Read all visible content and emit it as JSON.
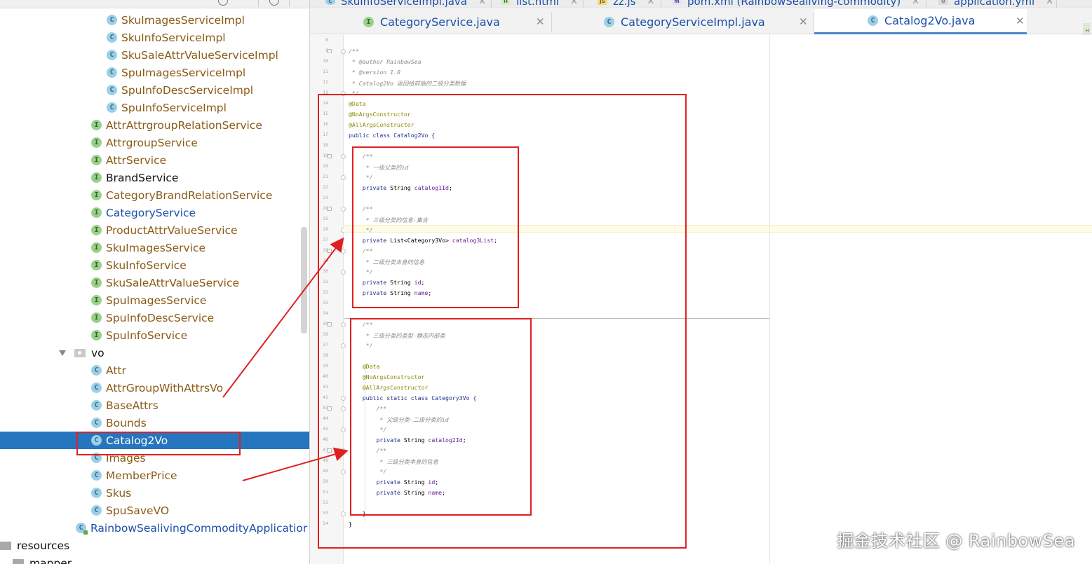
{
  "top_tabs": [
    {
      "label": "SkuInfoServiceImpl.java"
    },
    {
      "label": "list.html"
    },
    {
      "label": "zz.js"
    },
    {
      "label": "pom.xml (RainbowSealiving-commodity)"
    },
    {
      "label": "application.yml"
    }
  ],
  "editor_tabs": [
    {
      "label": "CategoryService.java",
      "icon": "interface-icon",
      "active": false
    },
    {
      "label": "CategoryServiceImpl.java",
      "icon": "class-icon",
      "active": false
    },
    {
      "label": "Catalog2Vo.java",
      "icon": "class-icon",
      "active": true
    }
  ],
  "tree": {
    "impl_items": [
      "SkuImagesServiceImpl",
      "SkuInfoServiceImpl",
      "SkuSaleAttrValueServiceImpl",
      "SpuImagesServiceImpl",
      "SpuInfoDescServiceImpl",
      "SpuInfoServiceImpl"
    ],
    "service_items": [
      "AttrAttrgroupRelationService",
      "AttrgroupService",
      "AttrService",
      "BrandService",
      "CategoryBrandRelationService",
      "CategoryService",
      "ProductAttrValueService",
      "SkuImagesService",
      "SkuInfoService",
      "SkuSaleAttrValueService",
      "SpuImagesService",
      "SpuInfoDescService",
      "SpuInfoService"
    ],
    "vo_folder": "vo",
    "vo_items": [
      "Attr",
      "AttrGroupWithAttrsVo",
      "BaseAttrs",
      "Bounds",
      "Catalog2Vo",
      "Images",
      "MemberPrice",
      "Skus",
      "SpuSaveVO"
    ],
    "selected": "Catalog2Vo",
    "app_class": "RainbowSealivingCommodityApplicatior",
    "resources_folder": "resources",
    "mapper_folder": "mapper"
  },
  "code": {
    "line_numbers": [
      "8",
      "9",
      "10",
      "11",
      "12",
      "13",
      "14",
      "15",
      "16",
      "17",
      "18",
      "19",
      "20",
      "21",
      "22",
      "23",
      "24",
      "25",
      "26",
      "27",
      "28",
      "29",
      "30",
      "31",
      "32",
      "33",
      "34",
      "35",
      "36",
      "37",
      "38",
      "39",
      "40",
      "41",
      "42",
      "43",
      "44",
      "45",
      "46",
      "47",
      "48",
      "49",
      "50",
      "51",
      "52",
      "53",
      "54"
    ],
    "lines": [
      {
        "t": "",
        "k": "plain"
      },
      {
        "t": "/**",
        "k": "cmt"
      },
      {
        "t": " * @author RainbowSea",
        "k": "cmt"
      },
      {
        "t": " * @version 1.0",
        "k": "cmt"
      },
      {
        "t": " * Catalog2Vo 返回给前端的二级分类数据",
        "k": "cmt"
      },
      {
        "t": " */",
        "k": "cmt"
      },
      {
        "t": "@Data",
        "k": "ann"
      },
      {
        "t": "@NoArgsConstructor",
        "k": "ann"
      },
      {
        "t": "@AllArgsConstructor",
        "k": "ann"
      },
      {
        "t": "public class Catalog2Vo {",
        "k": "kw"
      },
      {
        "t": "",
        "k": "plain"
      },
      {
        "t": "    /**",
        "k": "cmt"
      },
      {
        "t": "     * 一级父类的id",
        "k": "cmt"
      },
      {
        "t": "     */",
        "k": "cmt"
      },
      {
        "t": "    private String catalog1Id;",
        "k": "fieldline",
        "field": "catalog1Id"
      },
      {
        "t": "",
        "k": "plain"
      },
      {
        "t": "    /**",
        "k": "cmt"
      },
      {
        "t": "     * 三级分类的信息-集合",
        "k": "cmt"
      },
      {
        "t": "     */",
        "k": "cmt"
      },
      {
        "t": "    private List<Category3Vo> catalog3List;",
        "k": "fieldline",
        "field": "catalog3List"
      },
      {
        "t": "    /**",
        "k": "cmt"
      },
      {
        "t": "     * 二级分类本身的信息",
        "k": "cmt"
      },
      {
        "t": "     */",
        "k": "cmt"
      },
      {
        "t": "    private String id;",
        "k": "fieldline",
        "field": "id"
      },
      {
        "t": "    private String name;",
        "k": "fieldline",
        "field": "name"
      },
      {
        "t": "",
        "k": "plain"
      },
      {
        "t": "",
        "k": "plain"
      },
      {
        "t": "    /**",
        "k": "cmt"
      },
      {
        "t": "     * 三级分类的类型-静态内部类",
        "k": "cmt"
      },
      {
        "t": "     */",
        "k": "cmt"
      },
      {
        "t": "",
        "k": "plain"
      },
      {
        "t": "    @Data",
        "k": "ann"
      },
      {
        "t": "    @NoArgsConstructor",
        "k": "ann"
      },
      {
        "t": "    @AllArgsConstructor",
        "k": "ann"
      },
      {
        "t": "    public static class Category3Vo {",
        "k": "kw"
      },
      {
        "t": "        /**",
        "k": "cmt"
      },
      {
        "t": "         * 父级分类-二级分类的id",
        "k": "cmt"
      },
      {
        "t": "         */",
        "k": "cmt"
      },
      {
        "t": "        private String catalog2Id;",
        "k": "fieldline",
        "field": "catalog2Id"
      },
      {
        "t": "        /**",
        "k": "cmt"
      },
      {
        "t": "         * 三级分类本身的信息",
        "k": "cmt"
      },
      {
        "t": "         */",
        "k": "cmt"
      },
      {
        "t": "        private String id;",
        "k": "fieldline",
        "field": "id"
      },
      {
        "t": "        private String name;",
        "k": "fieldline",
        "field": "name"
      },
      {
        "t": "",
        "k": "plain"
      },
      {
        "t": "    }",
        "k": "plain"
      },
      {
        "t": "}",
        "k": "plain"
      }
    ]
  },
  "watermark": "掘金技术社区 @ RainbowSea",
  "colors": {
    "selection": "#2675bf",
    "annotation_red": "#e02020",
    "tab_text": "#1b4fa8",
    "tree_item_text": "#8a5a16"
  }
}
